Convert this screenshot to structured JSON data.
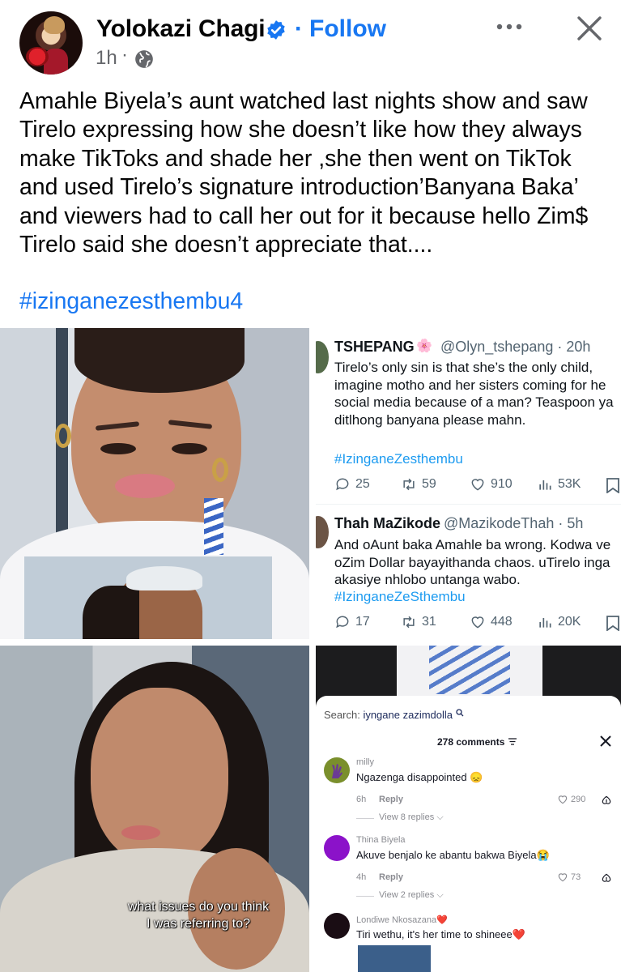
{
  "post": {
    "author": "Yolokazi Chagi",
    "separator": "·",
    "follow_label": "Follow",
    "time": "1h",
    "time_separator": "·",
    "caption": "Amahle Biyela’s aunt watched last nights show and saw Tirelo expressing how she doesn’t like how they always make TikToks and shade her ,she then went on TikTok and used Tirelo’s signature introduction’Banyana Baka’ and viewers had to call her out for it because hello Zim$ Tirelo said she doesn’t appreciate that....",
    "hashtag": "#izinganezesthembu4"
  },
  "icons": {
    "verified": "verified-badge-icon",
    "globe": "globe-icon",
    "more": "more-options-icon",
    "close": "close-icon"
  },
  "colors": {
    "facebook_blue": "#1877f2",
    "twitter_blue": "#1d9bf0",
    "muted": "#65676b"
  },
  "tweets": [
    {
      "name": "TSHEPANG",
      "handle": "@Olyn_tshepang · 20h",
      "lines": [
        "Tirelo’s only sin is that she’s the only child,",
        "imagine motho and her sisters coming for he",
        "social media because of a man? Teaspoon ya",
        "ditlhong banyana please mahn."
      ],
      "hashtag": "#IzinganeZesthembu",
      "replies": "25",
      "retweets": "59",
      "likes": "910",
      "views": "53K"
    },
    {
      "name": "Thah MaZikode",
      "handle": "@MazikodeThah · 5h",
      "lines": [
        "And oAunt baka Amahle ba wrong. Kodwa ve",
        "oZim Dollar bayayithanda chaos. uTirelo inga",
        "akasiye nhlobo untanga wabo."
      ],
      "hashtag": "#IzinganeZeSthembu",
      "replies": "17",
      "retweets": "31",
      "likes": "448",
      "views": "20K"
    }
  ],
  "video_subtitle": {
    "line1": "what issues do you think",
    "line2": "I was referring to?"
  },
  "tiktok": {
    "search_label": "Search:",
    "search_query": "iyngane zazimdolla",
    "comments_count": "278 comments",
    "comments": [
      {
        "user": "milly",
        "text": "Ngazenga disappointed 😞",
        "time": "6h",
        "reply_label": "Reply",
        "likes": "290",
        "view_replies": "View 8 replies",
        "avatar_color": "#7a8f2c"
      },
      {
        "user": "Thina Biyela",
        "text": "Akuve benjalo ke abantu bakwa Biyela😭",
        "time": "4h",
        "reply_label": "Reply",
        "likes": "73",
        "view_replies": "View 2 replies",
        "avatar_color": "#8b12c9"
      },
      {
        "user": "Londiwe Nkosazana❤️",
        "text": "Tiri wethu, it's her time to shineee❤️",
        "avatar_color": "#1a0d14"
      }
    ]
  }
}
